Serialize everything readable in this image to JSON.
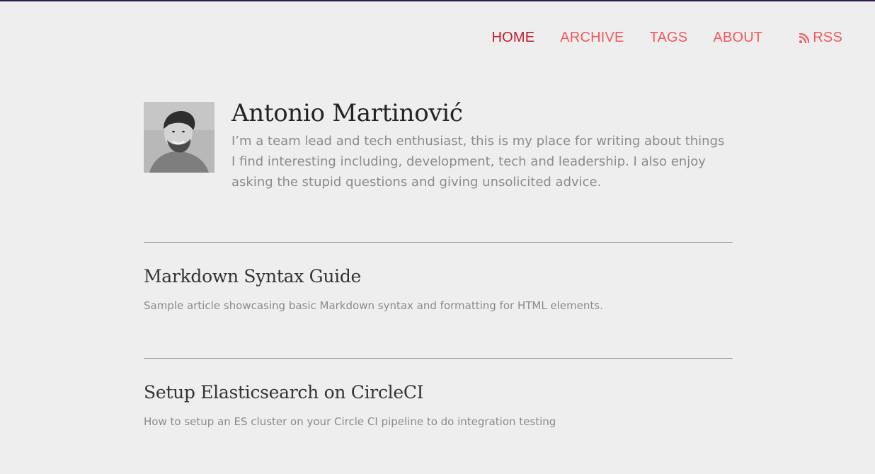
{
  "nav": {
    "items": [
      {
        "label": "HOME",
        "active": true
      },
      {
        "label": "ARCHIVE",
        "active": false
      },
      {
        "label": "TAGS",
        "active": false
      },
      {
        "label": "ABOUT",
        "active": false
      }
    ],
    "rss_label": "RSS",
    "rss_icon": "rss-icon"
  },
  "profile": {
    "name": "Antonio Martinović",
    "bio": "I’m a team lead and tech enthusiast, this is my place for writing about things I find interesting including, development, tech and leadership. I also enjoy asking the stupid questions and giving unsolicited advice."
  },
  "posts": [
    {
      "title": "Markdown Syntax Guide",
      "summary": "Sample article showcasing basic Markdown syntax and formatting for HTML elements."
    },
    {
      "title": "Setup Elasticsearch on CircleCI",
      "summary": "How to setup an ES cluster on your Circle CI pipeline to do integration testing"
    }
  ],
  "colors": {
    "background": "#eeeeee",
    "nav_link": "#f0595f",
    "nav_active": "#c21b33",
    "top_border": "#2d1b4e"
  }
}
